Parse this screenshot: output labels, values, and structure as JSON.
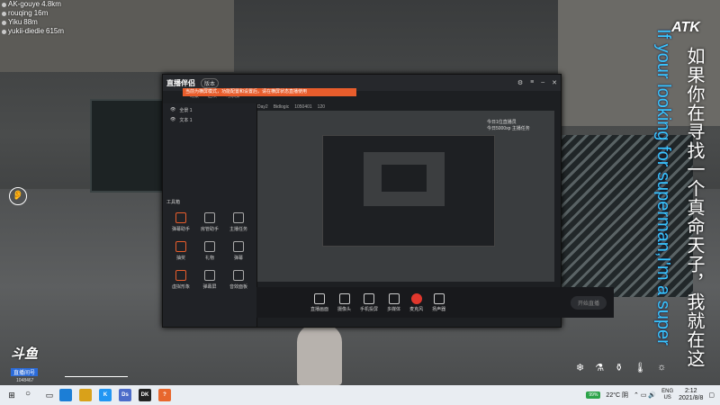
{
  "chat": [
    {
      "name": "AK-gouye",
      "dist": "4.8km"
    },
    {
      "name": "rouqing",
      "dist": "16m"
    },
    {
      "name": "Yiku",
      "dist": "88m"
    },
    {
      "name": "yukii-diedie",
      "dist": "615m"
    }
  ],
  "overlay": {
    "logo": "ATK",
    "english_text": "If your looking for superman,I'm a super",
    "chinese_text": "如果你在寻找一个真命天子，我就在这"
  },
  "app": {
    "brand": "直播伴侣",
    "version_badge": "版本",
    "notice": "当前为横屏模式，功能配置和设置后，请在横屏状态直播使用",
    "tabs": [
      "场景",
      "区块",
      "可添加"
    ],
    "scenes": [
      "全景 1",
      "文本 1"
    ],
    "infobar": [
      "Day2",
      "Bidlogic",
      "1050401",
      "120"
    ],
    "side_note": [
      "今日1位直播员",
      "今日5000xp 主播任务"
    ],
    "tools_title": "工具箱",
    "tools": [
      "弹幕助手",
      "房管助手",
      "主播任务",
      "抽奖",
      "礼物",
      "弹幕",
      "虚拟形象",
      "弹幕屏",
      "音效面板",
      "小黑屋",
      "",
      ""
    ],
    "bottom_buttons": [
      "直播画面",
      "摄像头",
      "手机投屏",
      "多媒体",
      "麦克风",
      "扬声器"
    ],
    "start_label": "开始直播"
  },
  "douyu": {
    "logo": "斗鱼",
    "sub": "直播间号",
    "room": "1048467"
  },
  "taskbar": {
    "apps": [
      {
        "label": "",
        "color": "#1c7ed6"
      },
      {
        "label": "",
        "color": "#d9a11a"
      },
      {
        "label": "K",
        "color": "#2196f3"
      },
      {
        "label": "Ds",
        "color": "#4c6cc9"
      },
      {
        "label": "DK",
        "color": "#222"
      },
      {
        "label": "?",
        "color": "#e8672d"
      }
    ],
    "battery": "99%",
    "weather": "22°C 阴",
    "lang_top": "ENG",
    "lang_bottom": "US",
    "time": "2:12",
    "date": "2021/8/8"
  }
}
